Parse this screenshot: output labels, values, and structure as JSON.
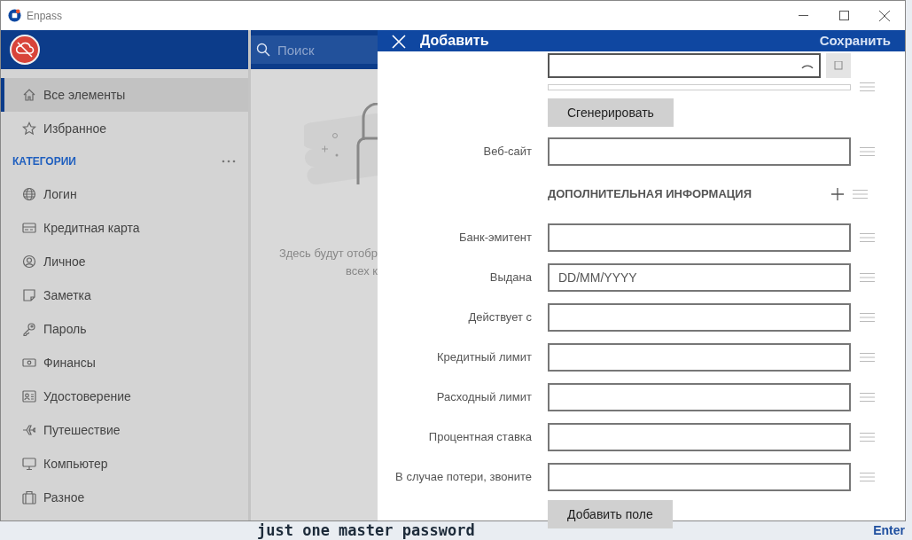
{
  "window": {
    "title": "Enpass"
  },
  "sidebar": {
    "items": [
      {
        "label": "Все элементы",
        "kind": "home",
        "selected": true
      },
      {
        "label": "Избранное",
        "kind": "star",
        "selected": false
      }
    ],
    "categories_title": "КАТЕГОРИИ",
    "categories": [
      {
        "label": "Логин",
        "kind": "globe",
        "selected": false
      },
      {
        "label": "Кредитная карта",
        "kind": "card",
        "selected": false
      },
      {
        "label": "Личное",
        "kind": "person",
        "selected": false
      },
      {
        "label": "Заметка",
        "kind": "note",
        "selected": false
      },
      {
        "label": "Пароль",
        "kind": "key",
        "selected": false
      },
      {
        "label": "Финансы",
        "kind": "money",
        "selected": false
      },
      {
        "label": "Удостоверение",
        "kind": "id",
        "selected": false
      },
      {
        "label": "Путешествие",
        "kind": "plane",
        "selected": false
      },
      {
        "label": "Компьютер",
        "kind": "monitor",
        "selected": false
      },
      {
        "label": "Разное",
        "kind": "bag",
        "selected": false
      }
    ]
  },
  "search": {
    "placeholder": "Поиск"
  },
  "empty_state": {
    "lines": [
      "Здесь будут отобр",
      "всех к"
    ]
  },
  "panel": {
    "title": "Добавить",
    "save": "Сохранить",
    "rows": [
      {
        "kind": "password"
      },
      {
        "kind": "meter",
        "level": 0
      },
      {
        "kind": "button",
        "label": "Сгенерировать"
      },
      {
        "kind": "field",
        "label": "Веб-сайт"
      },
      {
        "kind": "section",
        "label": "ДОПОЛНИТЕЛЬНАЯ ИНФОРМАЦИЯ"
      },
      {
        "kind": "field",
        "label": "Банк-эмитент"
      },
      {
        "kind": "field",
        "label": "Выдана",
        "placeholder": "DD/MM/YYYY"
      },
      {
        "kind": "field",
        "label": "Действует с"
      },
      {
        "kind": "field",
        "label": "Кредитный лимит"
      },
      {
        "kind": "field",
        "label": "Расходный лимит"
      },
      {
        "kind": "field",
        "label": "Процентная ставка"
      },
      {
        "kind": "field",
        "label": "В случае потери, звоните"
      }
    ],
    "add_field": "Добавить поле"
  },
  "background": {
    "headline": "just one master password",
    "link": "Enter"
  }
}
